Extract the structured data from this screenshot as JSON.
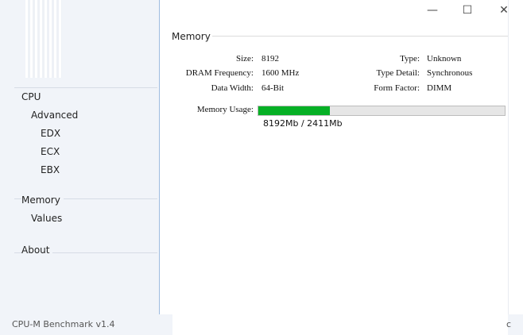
{
  "app": {
    "status_text": "CPU-M Benchmark v1.4",
    "status_tail": "c"
  },
  "window_controls": {
    "minimize": "—",
    "maximize": "☐",
    "close": "✕"
  },
  "sidebar": {
    "items": [
      {
        "label": "CPU"
      },
      {
        "label": "Advanced"
      },
      {
        "label": "EDX"
      },
      {
        "label": "ECX"
      },
      {
        "label": "EBX"
      },
      {
        "label": "Memory"
      },
      {
        "label": "Values"
      },
      {
        "label": "About"
      }
    ]
  },
  "memory": {
    "title": "Memory",
    "size_label": "Size:",
    "size_value": "8192",
    "dram_label": "DRAM Frequency:",
    "dram_value": "1600 MHz",
    "width_label": "Data Width:",
    "width_value": "64-Bit",
    "type_label": "Type:",
    "type_value": "Unknown",
    "detail_label": "Type Detail:",
    "detail_value": "Synchronous",
    "form_label": "Form Factor:",
    "form_value": "DIMM",
    "usage_label": "Memory Usage:",
    "usage_fraction": 0.29,
    "usage_text": "8192Mb / 2411Mb"
  }
}
